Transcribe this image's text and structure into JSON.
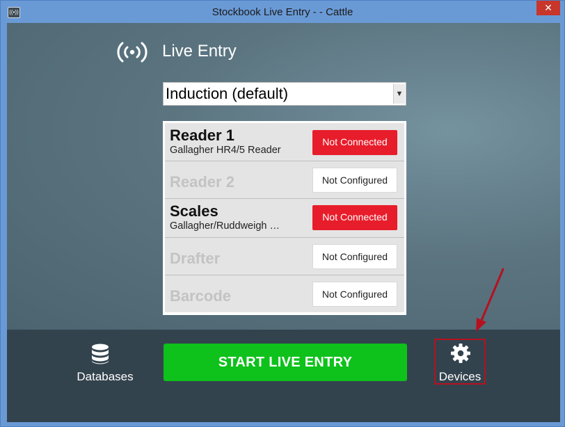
{
  "window": {
    "title": "Stockbook Live Entry -  - Cattle",
    "close_label": "✕"
  },
  "header": {
    "title": "Live Entry",
    "icon": "broadcast-icon"
  },
  "mode_select": {
    "value": "Induction (default)"
  },
  "devices": [
    {
      "name": "Reader 1",
      "subtitle": "Gallagher HR4/5 Reader",
      "status": "Not Connected",
      "enabled": true
    },
    {
      "name": "Reader 2",
      "subtitle": "",
      "status": "Not Configured",
      "enabled": false
    },
    {
      "name": "Scales",
      "subtitle": "Gallagher/Ruddweigh    …",
      "status": "Not Connected",
      "enabled": true
    },
    {
      "name": "Drafter",
      "subtitle": "",
      "status": "Not Configured",
      "enabled": false
    },
    {
      "name": "Barcode",
      "subtitle": "",
      "status": "Not Configured",
      "enabled": false
    }
  ],
  "footer": {
    "databases_label": "Databases",
    "databases_icon": "database-icon",
    "start_label": "START LIVE ENTRY",
    "devices_label": "Devices",
    "devices_icon": "gear-icon"
  },
  "colors": {
    "status_red": "#e81d2b",
    "start_green": "#0ec11b",
    "annotation_red": "#b5111f"
  }
}
